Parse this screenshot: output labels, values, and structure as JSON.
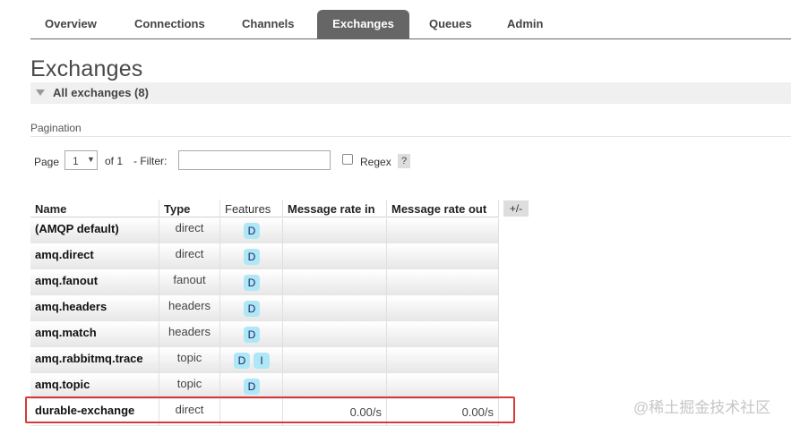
{
  "tabs": [
    {
      "label": "Overview",
      "active": false
    },
    {
      "label": "Connections",
      "active": false
    },
    {
      "label": "Channels",
      "active": false
    },
    {
      "label": "Exchanges",
      "active": true
    },
    {
      "label": "Queues",
      "active": false
    },
    {
      "label": "Admin",
      "active": false
    }
  ],
  "page_title": "Exchanges",
  "section": {
    "label": "All exchanges (8)"
  },
  "pagination": {
    "label": "Pagination",
    "page_text": "Page",
    "page_value": "1",
    "of_text": "of 1",
    "filter_text": "- Filter:",
    "filter_value": "",
    "regex_text": "Regex",
    "help_text": "?"
  },
  "table": {
    "headers": {
      "name": "Name",
      "type": "Type",
      "features": "Features",
      "rate_in": "Message rate in",
      "rate_out": "Message rate out"
    },
    "toggle_columns": "+/-",
    "rows": [
      {
        "name": "(AMQP default)",
        "type": "direct",
        "features": [
          "D"
        ],
        "rate_in": "",
        "rate_out": ""
      },
      {
        "name": "amq.direct",
        "type": "direct",
        "features": [
          "D"
        ],
        "rate_in": "",
        "rate_out": ""
      },
      {
        "name": "amq.fanout",
        "type": "fanout",
        "features": [
          "D"
        ],
        "rate_in": "",
        "rate_out": ""
      },
      {
        "name": "amq.headers",
        "type": "headers",
        "features": [
          "D"
        ],
        "rate_in": "",
        "rate_out": ""
      },
      {
        "name": "amq.match",
        "type": "headers",
        "features": [
          "D"
        ],
        "rate_in": "",
        "rate_out": ""
      },
      {
        "name": "amq.rabbitmq.trace",
        "type": "topic",
        "features": [
          "D",
          "I"
        ],
        "rate_in": "",
        "rate_out": ""
      },
      {
        "name": "amq.topic",
        "type": "topic",
        "features": [
          "D"
        ],
        "rate_in": "",
        "rate_out": ""
      },
      {
        "name": "durable-exchange",
        "type": "direct",
        "features": [],
        "rate_in": "0.00/s",
        "rate_out": "0.00/s"
      }
    ]
  },
  "watermark": "@稀土掘金技术社区",
  "colors": {
    "active_tab": "#666666",
    "badge": "#aee8f6",
    "highlight": "#d63a3a"
  }
}
